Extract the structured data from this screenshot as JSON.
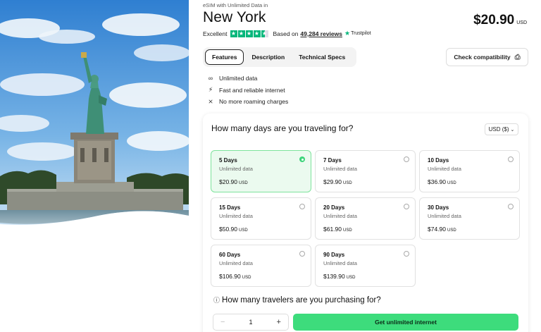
{
  "product": {
    "eyebrow": "eSIM with Unlimited Data in",
    "title": "New York",
    "price": "$20.90",
    "currency_code": "USD"
  },
  "rating": {
    "label": "Excellent",
    "based_on": "Based on",
    "reviews": "49,284 reviews",
    "provider": "Trustpilot",
    "stars": 4.5,
    "star_color": "#00b67a"
  },
  "tabs": [
    {
      "label": "Features",
      "active": true
    },
    {
      "label": "Description",
      "active": false
    },
    {
      "label": "Technical Specs",
      "active": false
    }
  ],
  "check_compatibility": {
    "label": "Check compatibility",
    "icon": "phone-check-icon"
  },
  "features": [
    {
      "icon": "infinity-icon",
      "label": "Unlimited data"
    },
    {
      "icon": "bolt-icon",
      "label": "Fast and reliable internet"
    },
    {
      "icon": "no-roaming-icon",
      "label": "No more roaming charges"
    }
  ],
  "days_section": {
    "question": "How many days are you traveling for?",
    "currency_select": "USD ($)"
  },
  "plans": [
    {
      "days": "5 Days",
      "data": "Unlimited data",
      "price": "$20.90",
      "unit": "USD",
      "selected": true
    },
    {
      "days": "7 Days",
      "data": "Unlimited data",
      "price": "$29.90",
      "unit": "USD",
      "selected": false
    },
    {
      "days": "10 Days",
      "data": "Unlimited data",
      "price": "$36.90",
      "unit": "USD",
      "selected": false
    },
    {
      "days": "15 Days",
      "data": "Unlimited data",
      "price": "$50.90",
      "unit": "USD",
      "selected": false
    },
    {
      "days": "20 Days",
      "data": "Unlimited data",
      "price": "$61.90",
      "unit": "USD",
      "selected": false
    },
    {
      "days": "30 Days",
      "data": "Unlimited data",
      "price": "$74.90",
      "unit": "USD",
      "selected": false
    },
    {
      "days": "60 Days",
      "data": "Unlimited data",
      "price": "$106.90",
      "unit": "USD",
      "selected": false
    },
    {
      "days": "90 Days",
      "data": "Unlimited data",
      "price": "$139.90",
      "unit": "USD",
      "selected": false
    }
  ],
  "travelers": {
    "question": "How many travelers are you purchasing for?",
    "quantity": "1",
    "minus": "−",
    "plus": "+"
  },
  "cta": {
    "label": "Get unlimited internet",
    "color": "#3ddc7c"
  }
}
